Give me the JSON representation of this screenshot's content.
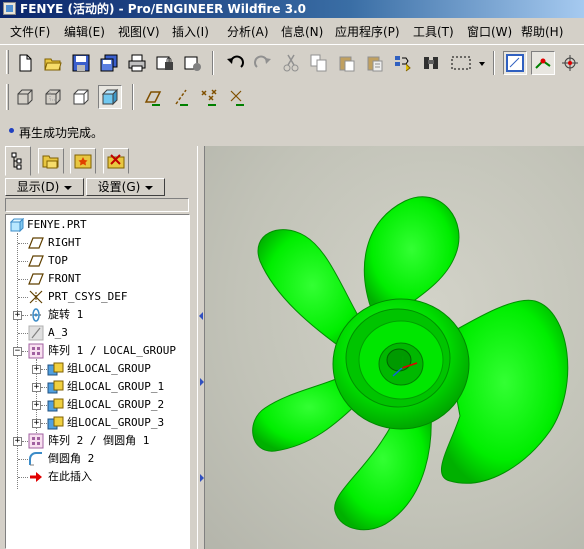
{
  "window": {
    "title": "FENYE (活动的) - Pro/ENGINEER Wildfire 3.0"
  },
  "menu": {
    "items": [
      "文件(F)",
      "编辑(E)",
      "视图(V)",
      "插入(I)",
      "分析(A)",
      "信息(N)",
      "应用程序(P)",
      "工具(T)",
      "窗口(W)",
      "帮助(H)"
    ]
  },
  "status": {
    "message": "再生成功完成。"
  },
  "panel": {
    "show_label": "显示(D)",
    "settings_label": "设置(G)"
  },
  "tree": {
    "items": [
      {
        "label": "FENYE.PRT",
        "icon": "part-icon"
      },
      {
        "label": "RIGHT",
        "icon": "datum-plane-icon"
      },
      {
        "label": "TOP",
        "icon": "datum-plane-icon"
      },
      {
        "label": "FRONT",
        "icon": "datum-plane-icon"
      },
      {
        "label": "PRT_CSYS_DEF",
        "icon": "csys-icon"
      },
      {
        "label": "旋转 1",
        "icon": "revolve-icon"
      },
      {
        "label": "A_3",
        "icon": "axis-icon"
      },
      {
        "label": "阵列 1 / LOCAL_GROUP",
        "icon": "pattern-icon"
      },
      {
        "label": "组LOCAL_GROUP",
        "icon": "group-icon"
      },
      {
        "label": "组LOCAL_GROUP_1",
        "icon": "group-icon"
      },
      {
        "label": "组LOCAL_GROUP_2",
        "icon": "group-icon"
      },
      {
        "label": "组LOCAL_GROUP_3",
        "icon": "group-icon"
      },
      {
        "label": "阵列 2 / 倒圆角 1",
        "icon": "pattern-icon"
      },
      {
        "label": "倒圆角 2",
        "icon": "round-icon"
      },
      {
        "label": "在此插入",
        "icon": "insert-arrow-icon"
      }
    ]
  },
  "colors": {
    "model_green": "#00ee00",
    "title_blue": "#0a246a",
    "viewport_bg": "#c4c5ba"
  }
}
